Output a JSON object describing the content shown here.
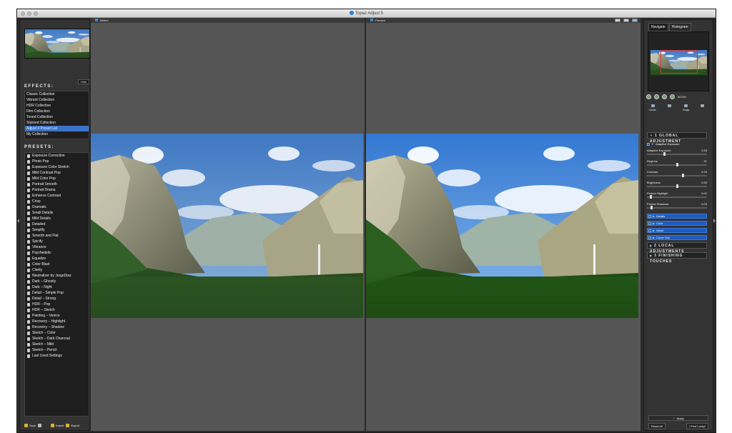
{
  "window": {
    "title": "Topaz Adjust 5"
  },
  "left_panel": {
    "hide_label": "Hide",
    "effects_title": "EFFECTS:",
    "effects": [
      {
        "label": "Classic Collection"
      },
      {
        "label": "Vibrant Collection"
      },
      {
        "label": "HDR Collection"
      },
      {
        "label": "Film Collection"
      },
      {
        "label": "Toned Collection"
      },
      {
        "label": "Stylized Collection"
      },
      {
        "label": "Adjust 4 Preset List",
        "selected": true
      },
      {
        "label": "My Collection"
      }
    ],
    "presets_title": "PRESETS:",
    "presets": [
      "Exposure Correction",
      "Photo Pop",
      "Exposure Color Stretch",
      "Mild Contrast Pop",
      "Mild Color Pop",
      "Portrait Smooth",
      "Portrait Drama",
      "Enhance Contrast",
      "Crisp",
      "Dramatic",
      "Small Details",
      "Mild Details",
      "Detailed",
      "Simplify",
      "Smooth and Flat",
      "Spicify",
      "Vibrance",
      "Psychedelic",
      "Equalize",
      "Color Blast",
      "Clarity",
      "Neutralizer by JorgeDiaz",
      "Dark – Ghostly",
      "Dark – Night",
      "Detail – Simple Pop",
      "Detail – Strong",
      "HDR – Pop",
      "HDR – Sketch",
      "Painting – Venice",
      "Recovery – Highlight",
      "Recovery – Shadow",
      "Sketch – Color",
      "Sketch – Dark Charcoal",
      "Sketch – Mild",
      "Sketch – Pencil",
      "Last Used Settings"
    ],
    "footer": {
      "save": "Save",
      "import": "Import",
      "export": "Export"
    }
  },
  "center": {
    "before_label": "Before",
    "preview_label": "Preview"
  },
  "right_panel": {
    "tabs": [
      "Navigate",
      "Histogram"
    ],
    "zoom_value": "50.0%",
    "tools": [
      "Undo",
      "",
      "Snap",
      ""
    ],
    "sections": {
      "global": "1  GLOBAL ADJUSTMENT",
      "local": "2  LOCAL ADJUSTMENTS",
      "finishing": "3  FINISHING TOUCHES"
    },
    "adaptive_exposure_title": "Adaptive Exposure",
    "sliders": [
      {
        "label": "Adaptive Exposure",
        "value": "0.28",
        "level": 0.28
      },
      {
        "label": "Regions",
        "value": "31",
        "level": 0.5
      },
      {
        "label": "Contrast",
        "value": "0.29",
        "level": 0.6
      },
      {
        "label": "Brightness",
        "value": "0.50",
        "level": 0.5
      },
      {
        "label": "Protect Highlight",
        "value": "0.02",
        "level": 0.05
      },
      {
        "label": "Protect Shadows",
        "value": "0.03",
        "level": 0.06
      }
    ],
    "sub_bars": [
      "Details",
      "Color",
      "Noise",
      "Curve Tool"
    ],
    "apply_label": "Apply",
    "reset_label": "Reset All",
    "lucky_label": "I Feel Lucky!"
  }
}
